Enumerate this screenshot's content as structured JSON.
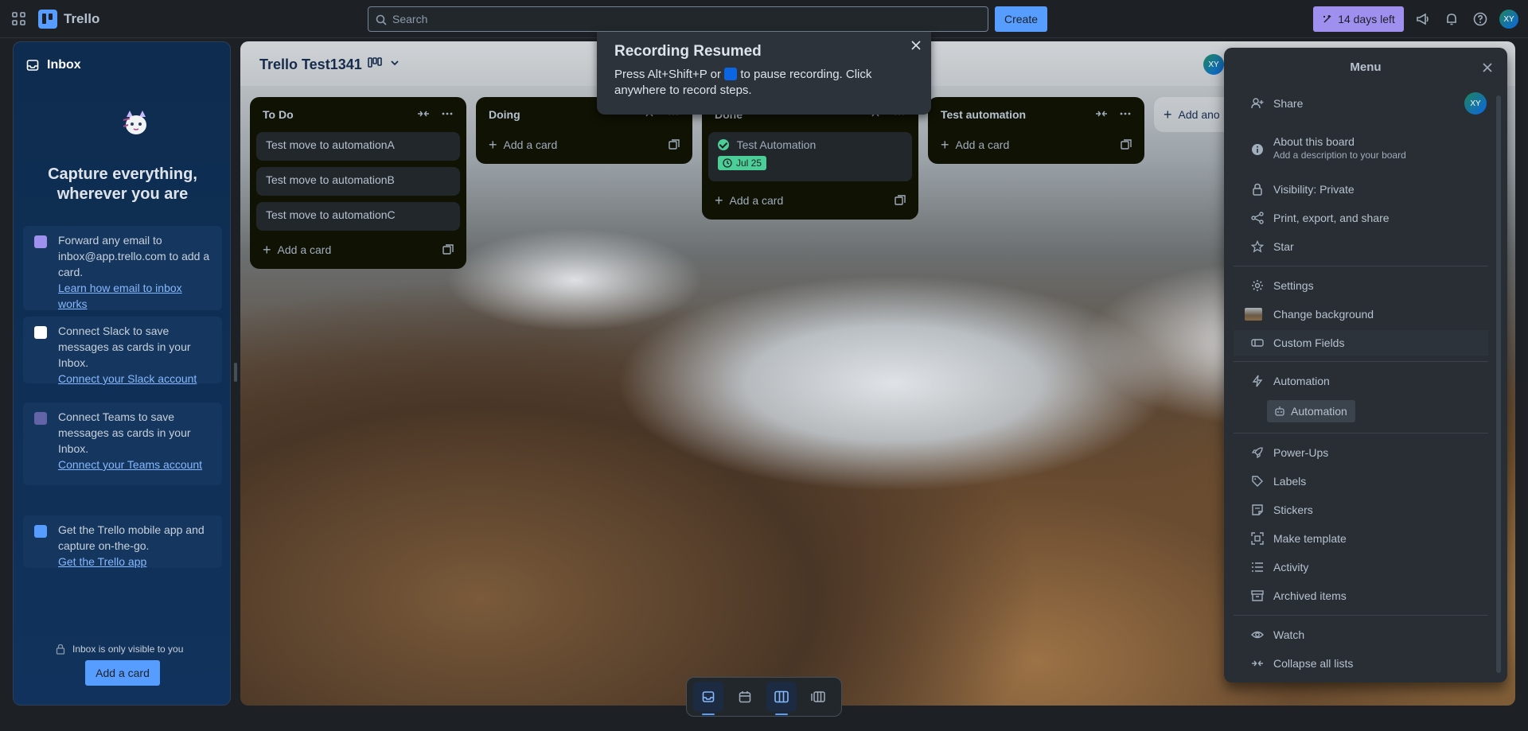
{
  "topbar": {
    "app_name": "Trello",
    "search_placeholder": "Search",
    "create_label": "Create",
    "trial_label": "14 days left",
    "avatar_initials": "XY"
  },
  "inbox": {
    "title": "Inbox",
    "headline": "Capture everything, wherever you are",
    "cards": [
      {
        "text": "Forward any email to inbox@app.trello.com to add a card.",
        "link": "Learn how email to inbox works"
      },
      {
        "text": "Connect Slack to save messages as cards in your Inbox.",
        "link": "Connect your Slack account"
      },
      {
        "text": "Connect Teams to save messages as cards in your Inbox.",
        "link": "Connect your Teams account"
      },
      {
        "text": "Get the Trello mobile app and capture on-the-go.",
        "link": "Get the Trello app"
      }
    ],
    "privacy_note": "Inbox is only visible to you",
    "add_card_label": "Add a card"
  },
  "board": {
    "title": "Trello Test1341",
    "avatar_initials": "XY",
    "add_another_label": "Add ano",
    "lists": [
      {
        "title": "To Do",
        "cards": [
          "Test move to automationA",
          "Test move to automationB",
          "Test move to automationC"
        ],
        "add_label": "Add a card"
      },
      {
        "title": "Doing",
        "cards": [],
        "add_label": "Add a card"
      },
      {
        "title": "Done",
        "done_card": {
          "title": "Test Automation",
          "date": "Jul 25"
        },
        "add_label": "Add a card"
      },
      {
        "title": "Test automation",
        "cards": [],
        "add_label": "Add a card"
      }
    ]
  },
  "toast": {
    "title": "Recording Resumed",
    "body_before": "Press Alt+Shift+P or",
    "body_after": "to pause recording. Click anywhere to record steps."
  },
  "menu": {
    "title": "Menu",
    "avatar_initials": "XY",
    "items": {
      "share": "Share",
      "about": "About this board",
      "about_sub": "Add a description to your board",
      "visibility": "Visibility: Private",
      "print": "Print, export, and share",
      "star": "Star",
      "settings": "Settings",
      "background": "Change background",
      "custom_fields": "Custom Fields",
      "automation": "Automation",
      "automation_chip": "Automation",
      "power_ups": "Power-Ups",
      "labels": "Labels",
      "stickers": "Stickers",
      "template": "Make template",
      "activity": "Activity",
      "archived": "Archived items",
      "watch": "Watch",
      "collapse": "Collapse all lists"
    }
  },
  "colors": {
    "accent": "#579dff",
    "trial": "#9f8fef",
    "done_green": "#4bce97"
  }
}
